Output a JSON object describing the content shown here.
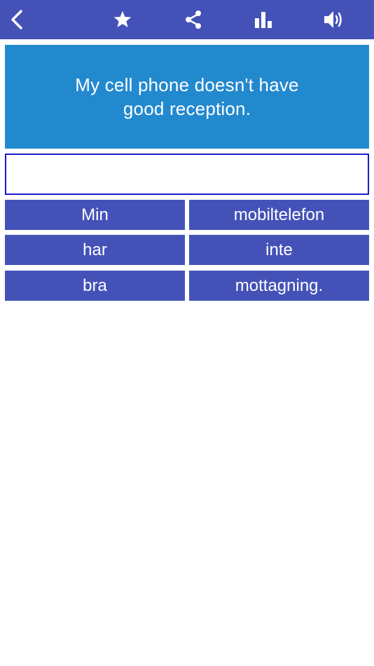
{
  "toolbar": {
    "background_color": "#4452b8",
    "icons": [
      "back-icon",
      "star-icon",
      "share-icon",
      "stats-icon",
      "speaker-icon"
    ]
  },
  "prompt": {
    "text": "My cell phone doesn't have good reception.",
    "background_color": "#2389cf"
  },
  "answer": {
    "value": "",
    "border_color": "#1a1ad6"
  },
  "words": [
    {
      "label": "Min"
    },
    {
      "label": "mobiltelefon"
    },
    {
      "label": "har"
    },
    {
      "label": "inte"
    },
    {
      "label": "bra"
    },
    {
      "label": "mottagning."
    }
  ]
}
